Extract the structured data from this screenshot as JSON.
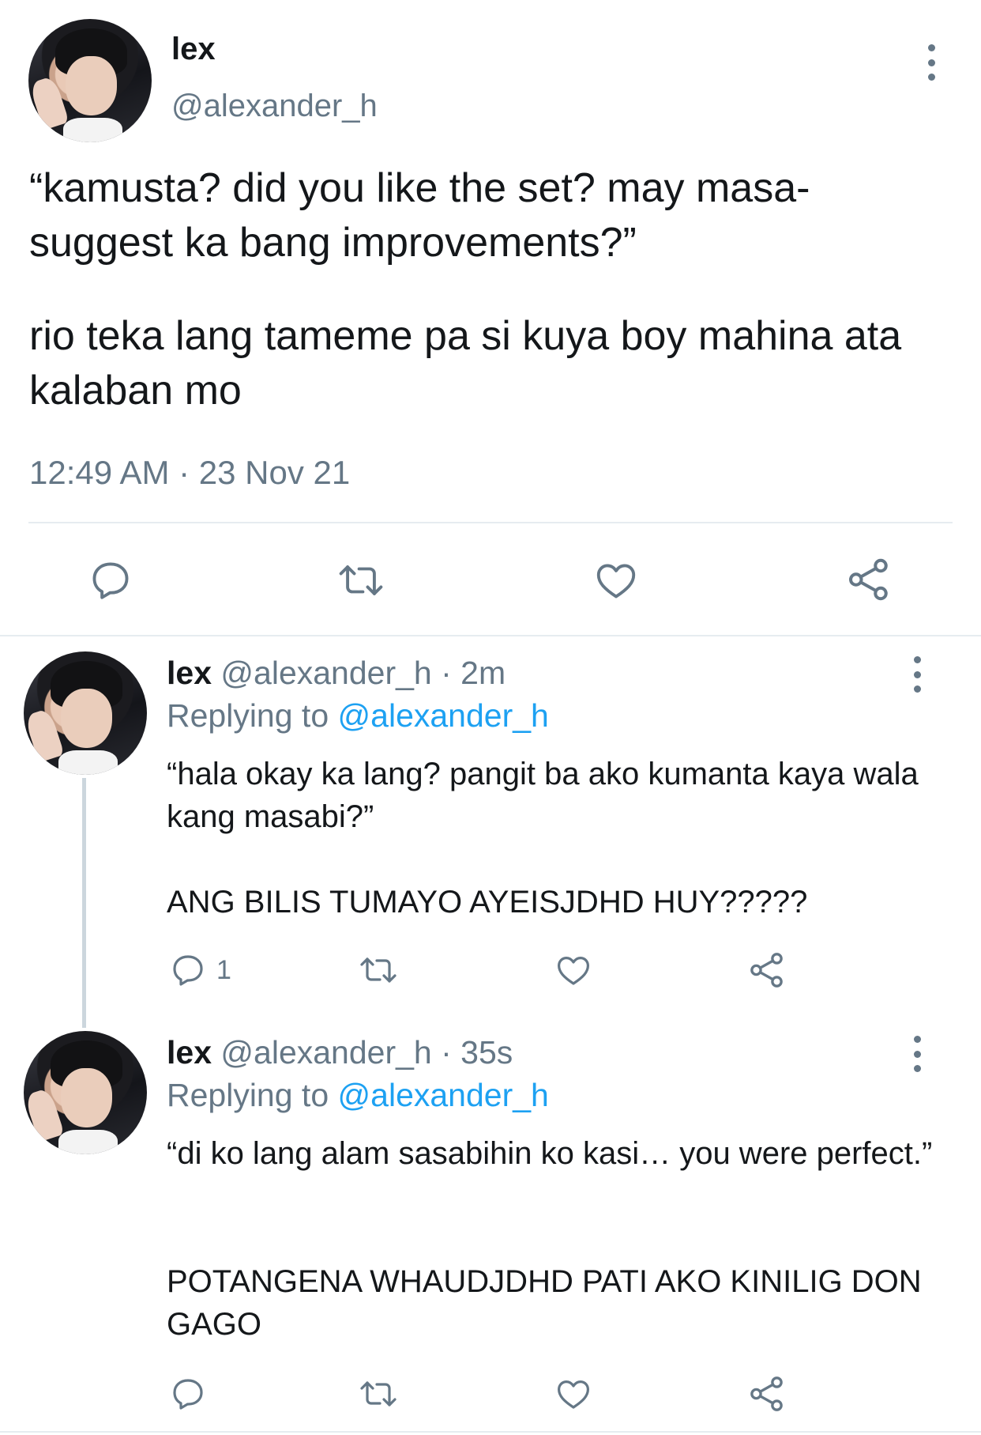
{
  "main_tweet": {
    "author_name": "lex",
    "author_handle": "@alexander_h",
    "paragraph_1": "“kamusta? did you like the set? may masa-suggest ka bang improvements?”",
    "paragraph_2": "rio teka lang tameme pa si kuya boy mahina ata kalaban mo",
    "timestamp": "12:49 AM · 23 Nov 21",
    "icons": [
      "reply-icon",
      "retweet-icon",
      "like-icon",
      "share-icon"
    ]
  },
  "replies": [
    {
      "author_name": "lex",
      "author_handle": "@alexander_h",
      "time": "· 2m",
      "replying_prefix": "Replying to",
      "replying_to": "@alexander_h",
      "paragraph_1": "“hala okay ka lang? pangit ba ako kumanta kaya wala kang masabi?”",
      "paragraph_2": "ANG BILIS TUMAYO AYEISJDHD HUY?????",
      "reply_count": "1"
    },
    {
      "author_name": "lex",
      "author_handle": "@alexander_h",
      "time": "· 35s",
      "replying_prefix": "Replying to",
      "replying_to": "@alexander_h",
      "paragraph_1": "“di ko lang alam sasabihin ko kasi… you were perfect.”",
      "paragraph_2": "POTANGENA WHAUDJDHD PATI AKO KINILIG DON GAGO",
      "reply_count": ""
    }
  ],
  "colors": {
    "text": "#14171a",
    "secondary": "#657786",
    "link": "#1da1f2",
    "divider": "#e6ecf0",
    "thread_line": "#ccd6dd"
  }
}
